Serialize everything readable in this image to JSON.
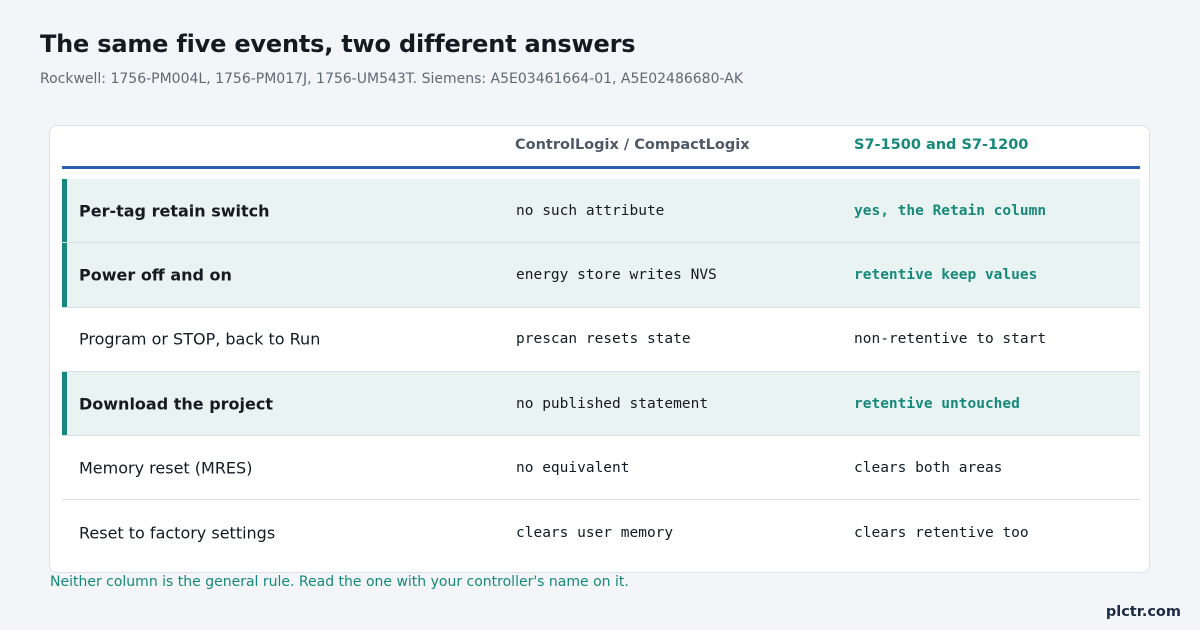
{
  "header": {
    "title": "The same five events, two different answers",
    "subtitle": "Rockwell: 1756-PM004L, 1756-PM017J, 1756-UM543T. Siemens: A5E03461664-01, A5E02486680-AK"
  },
  "table": {
    "columns": [
      "",
      "ControlLogix / CompactLogix",
      "S7-1500 and S7-1200"
    ],
    "rows": [
      {
        "event": "Per-tag retain switch",
        "rockwell": "no such attribute",
        "siemens": "yes, the Retain column",
        "highlighted": true
      },
      {
        "event": "Power off and on",
        "rockwell": "energy store writes NVS",
        "siemens": "retentive keep values",
        "highlighted": true
      },
      {
        "event": "Program or STOP, back to Run",
        "rockwell": "prescan resets state",
        "siemens": "non-retentive to start",
        "highlighted": false
      },
      {
        "event": "Download the project",
        "rockwell": "no published statement",
        "siemens": "retentive untouched",
        "highlighted": true
      },
      {
        "event": "Memory reset (MRES)",
        "rockwell": "no equivalent",
        "siemens": "clears both areas",
        "highlighted": false
      },
      {
        "event": "Reset to factory settings",
        "rockwell": "clears user memory",
        "siemens": "clears retentive too",
        "highlighted": false
      }
    ]
  },
  "footnote": "Neither column is the general rule. Read the one with your controller's name on it.",
  "brand": "plctr.com",
  "colors": {
    "accent_teal": "#16897a",
    "header_rule_blue": "#2b5fb0",
    "highlight_bg": "#e9f3f1",
    "page_bg": "#f3f5f8"
  }
}
